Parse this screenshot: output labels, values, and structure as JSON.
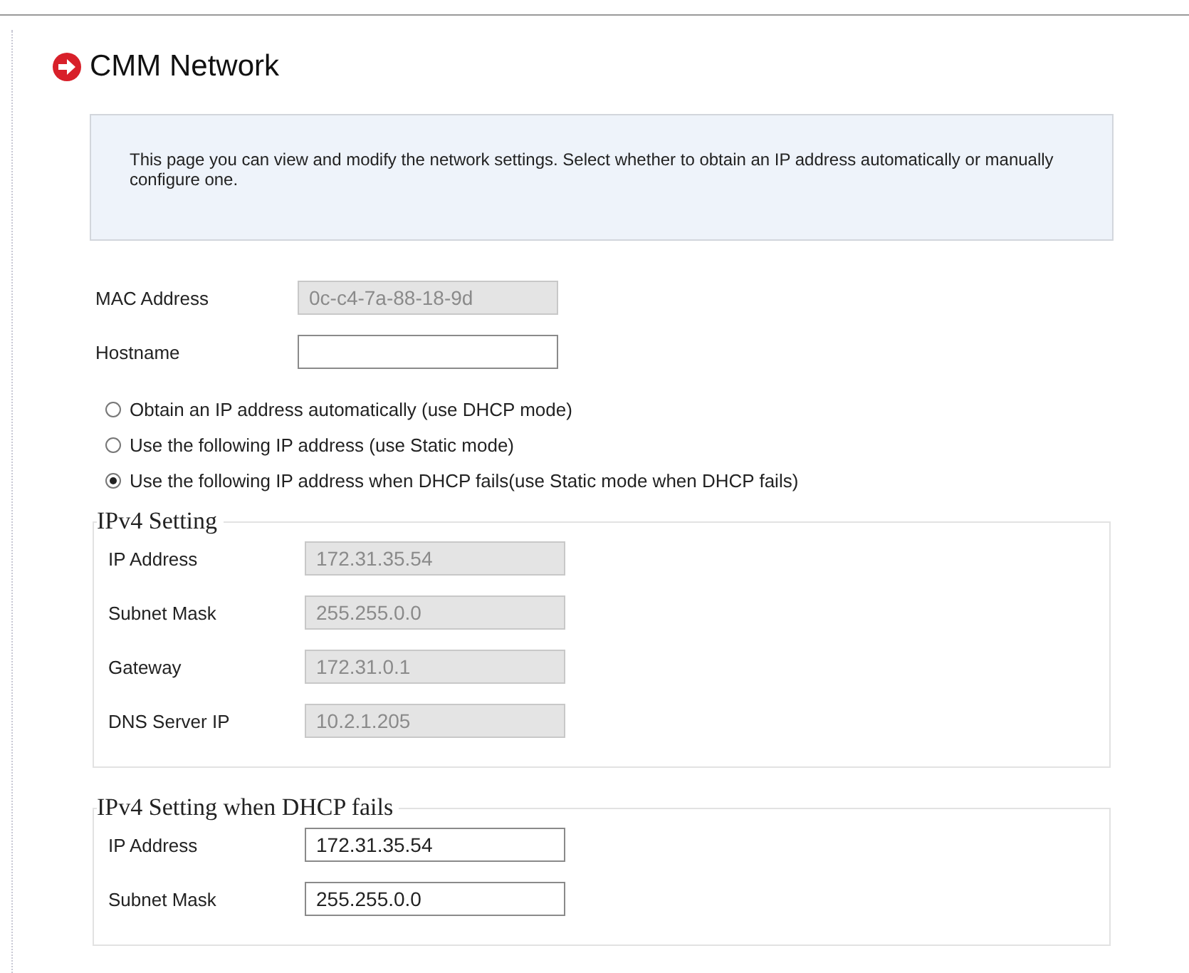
{
  "page": {
    "title": "CMM Network"
  },
  "info": "This page you can view and modify the network settings. Select whether to obtain an IP address automatically or manually configure one.",
  "fields": [
    {
      "label": "MAC Address",
      "value": "0c-c4-7a-88-18-9d",
      "disabled": true
    },
    {
      "label": "Hostname",
      "disabled": false
    }
  ],
  "modes": [
    {
      "label": "Obtain an IP address automatically (use DHCP mode)",
      "selected": false
    },
    {
      "label": "Use the following IP address (use Static mode)",
      "selected": false
    },
    {
      "label": "Use the following IP address when DHCP fails(use Static mode when DHCP fails)",
      "selected": true
    }
  ],
  "sections": [
    {
      "legend": "IPv4 Setting",
      "fields": [
        {
          "label": "IP Address",
          "value": "172.31.35.54",
          "disabled": true
        },
        {
          "label": "Subnet Mask",
          "value": "255.255.0.0",
          "disabled": true
        },
        {
          "label": "Gateway",
          "value": "172.31.0.1",
          "disabled": true
        },
        {
          "label": "DNS Server IP",
          "value": "10.2.1.205",
          "disabled": true
        }
      ]
    },
    {
      "legend": "IPv4 Setting when DHCP fails",
      "fields": [
        {
          "label": "IP Address",
          "value": "172.31.35.54",
          "disabled": false
        },
        {
          "label": "Subnet Mask",
          "value": "255.255.0.0",
          "disabled": false
        }
      ]
    }
  ]
}
